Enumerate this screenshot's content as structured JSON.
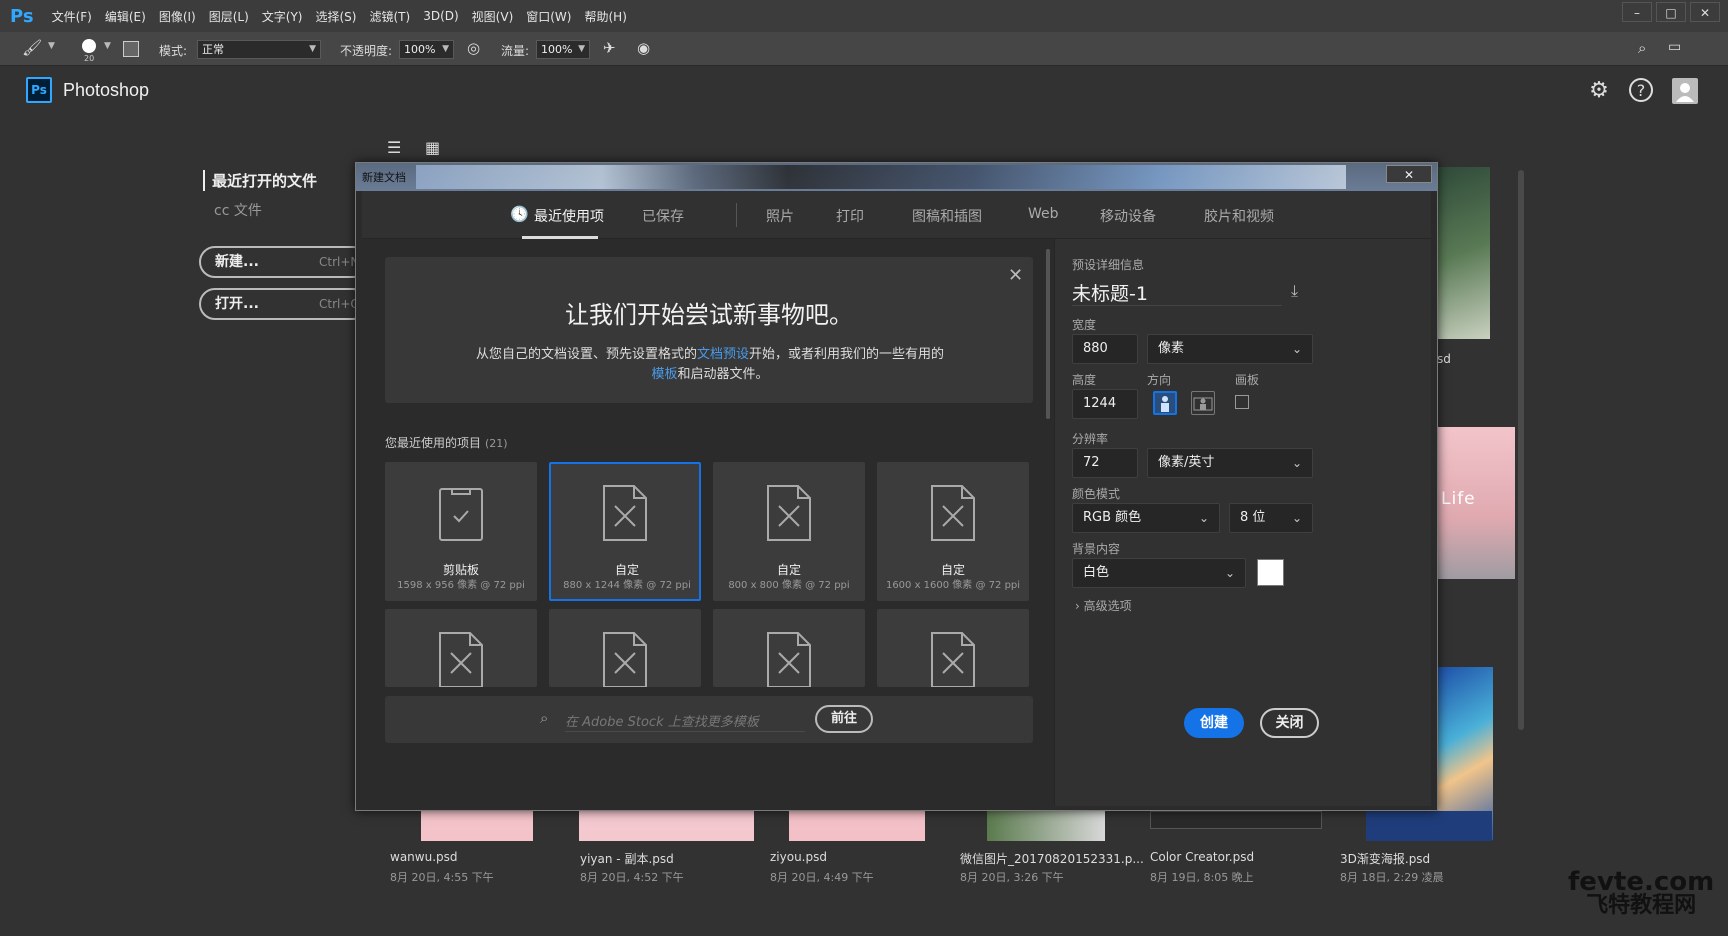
{
  "menubar": {
    "logo": "Ps",
    "items": [
      "文件(F)",
      "编辑(E)",
      "图像(I)",
      "图层(L)",
      "文字(Y)",
      "选择(S)",
      "滤镜(T)",
      "3D(D)",
      "视图(V)",
      "窗口(W)",
      "帮助(H)"
    ]
  },
  "window_controls": {
    "minimize": "–",
    "restore": "□",
    "close": "✕"
  },
  "options": {
    "brush_size": "20",
    "mode_label": "模式:",
    "mode_value": "正常",
    "opacity_label": "不透明度:",
    "opacity_value": "100%",
    "flow_label": "流量:",
    "flow_value": "100%"
  },
  "home": {
    "badge": "Ps",
    "app_name": "Photoshop",
    "nav_recent": "最近打开的文件",
    "nav_cc": "cc 文件",
    "new_label": "新建...",
    "new_shortcut": "Ctrl+N",
    "open_label": "打开...",
    "open_shortcut": "Ctrl+O",
    "files": [
      {
        "name": "wanwu.psd",
        "date": "8月 20日, 4:55 下午"
      },
      {
        "name": "yiyan - 副本.psd",
        "date": "8月 20日, 4:52 下午"
      },
      {
        "name": "ziyou.psd",
        "date": "8月 20日, 4:49 下午"
      },
      {
        "name": "微信图片_20170820152331.p...",
        "date": "8月 20日, 3:26 下午"
      },
      {
        "name": "Color Creator.psd",
        "date": "8月 19日, 8:05 晚上"
      },
      {
        "name": "3D渐变海报.psd",
        "date": "8月 18日, 2:29 凌晨"
      }
    ],
    "side_file_fragment": "sd",
    "side_thumb_text": "Life"
  },
  "dialog": {
    "title": "新建文档",
    "close": "✕",
    "tabs": [
      "最近使用项",
      "已保存",
      "照片",
      "打印",
      "图稿和插图",
      "Web",
      "移动设备",
      "胶片和视频"
    ],
    "welcome": {
      "title": "让我们开始尝试新事物吧。",
      "text_1": "从您自己的文档设置、预先设置格式的",
      "link_1": "文档预设",
      "text_2": "开始，或者利用我们的一些有用的",
      "link_2": "模板",
      "text_3": "和启动器文件。"
    },
    "recent_label": "您最近使用的项目",
    "recent_count": "(21)",
    "cards": [
      {
        "name": "剪贴板",
        "dim": "1598 x 956 像素 @ 72 ppi"
      },
      {
        "name": "自定",
        "dim": "880 x 1244 像素 @ 72 ppi"
      },
      {
        "name": "自定",
        "dim": "800 x 800 像素 @ 72 ppi"
      },
      {
        "name": "自定",
        "dim": "1600 x 1600 像素 @ 72 ppi"
      }
    ],
    "stock_placeholder": "在 Adobe Stock 上查找更多模板",
    "stock_go": "前往"
  },
  "preset": {
    "section_label": "预设详细信息",
    "doc_title": "未标题-1",
    "width_label": "宽度",
    "width_value": "880",
    "width_unit": "像素",
    "height_label": "高度",
    "height_value": "1244",
    "orientation_label": "方向",
    "artboard_label": "画板",
    "resolution_label": "分辨率",
    "resolution_value": "72",
    "resolution_unit": "像素/英寸",
    "color_mode_label": "颜色模式",
    "color_mode_value": "RGB 颜色",
    "bit_depth_value": "8 位",
    "background_label": "背景内容",
    "background_value": "白色",
    "advanced_label": "高级选项",
    "create": "创建",
    "close": "关闭"
  },
  "watermark": {
    "line1": "fevte.com",
    "line2": "飞特教程网"
  }
}
